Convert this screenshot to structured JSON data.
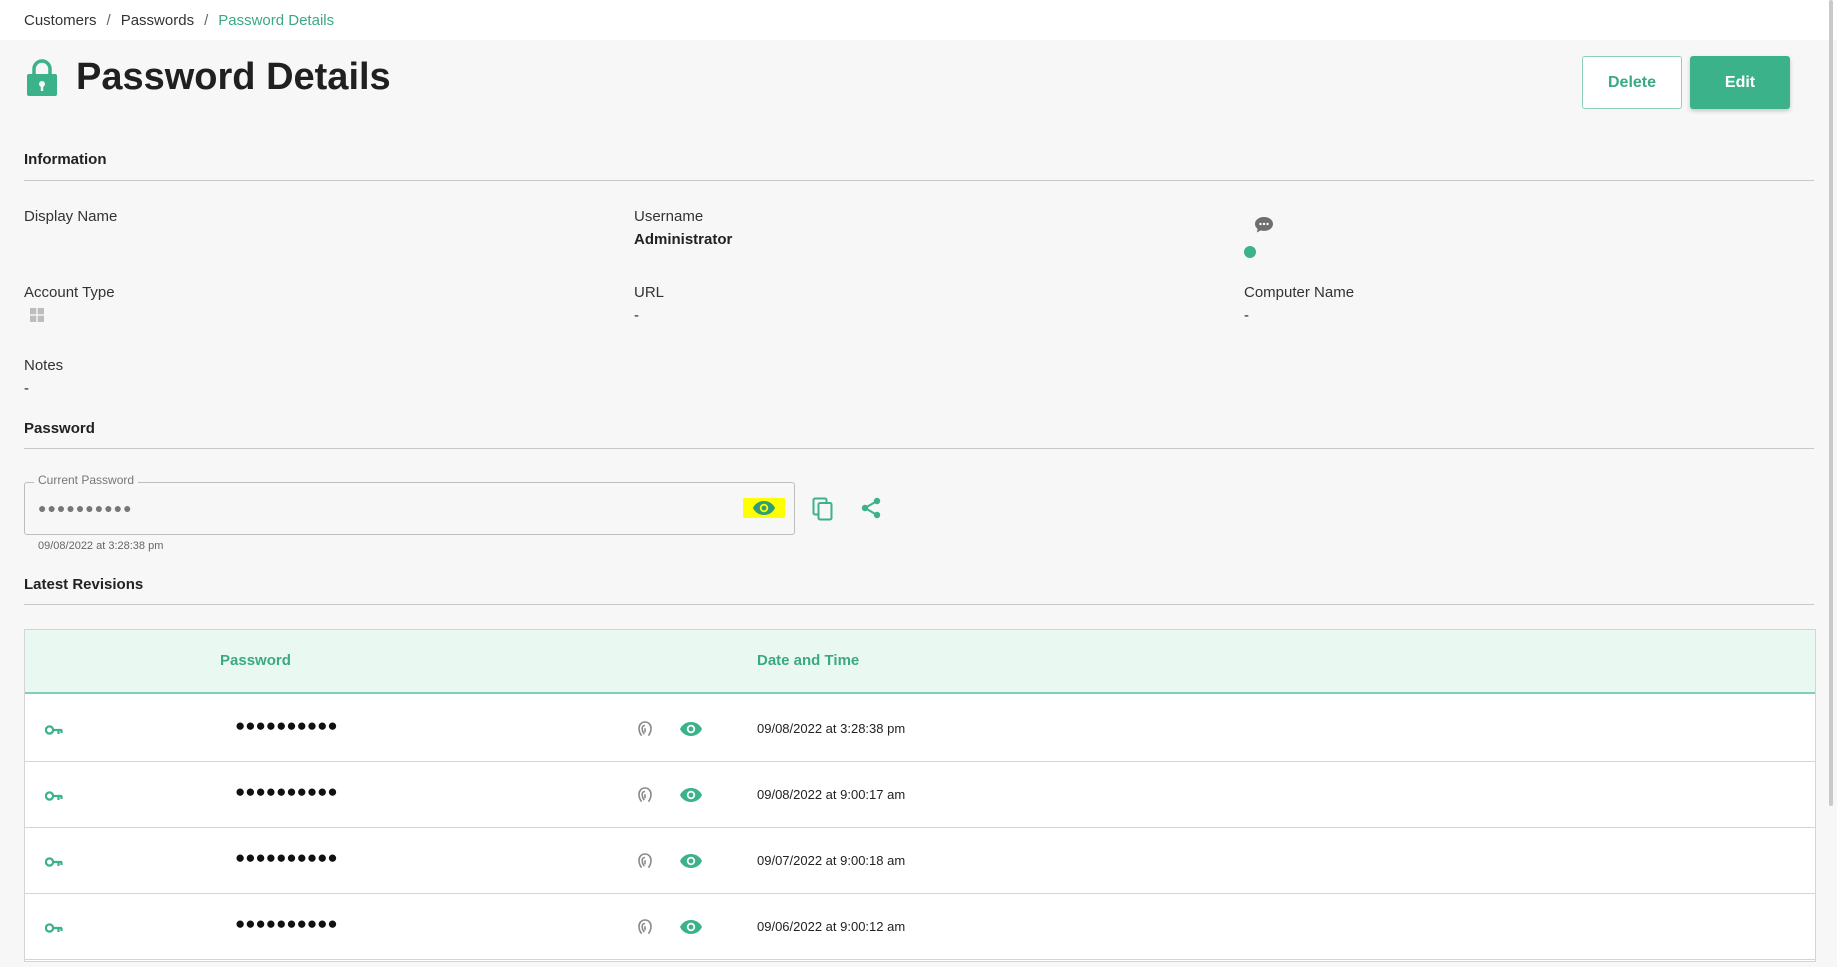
{
  "breadcrumb": {
    "items": [
      "Customers",
      "Passwords"
    ],
    "separator": "/",
    "current": "Password Details"
  },
  "page": {
    "title": "Password Details",
    "icon": "lock-icon"
  },
  "actions": {
    "delete_label": "Delete",
    "edit_label": "Edit"
  },
  "information": {
    "section_title": "Information",
    "display_name_label": "Display Name",
    "display_name_value": "",
    "username_label": "Username",
    "username_value": "Administrator",
    "account_type_label": "Account Type",
    "account_type_icon": "windows-icon",
    "url_label": "URL",
    "url_value": "-",
    "computer_name_label": "Computer Name",
    "computer_name_value": "-",
    "notes_label": "Notes",
    "notes_value": "-",
    "status_color": "#3bb28a"
  },
  "password": {
    "section_title": "Password",
    "field_label": "Current Password",
    "masked_value": "●●●●●●●●●●",
    "timestamp": "09/08/2022 at 3:28:38 pm"
  },
  "revisions": {
    "section_title": "Latest Revisions",
    "columns": [
      "Password",
      "Date and Time"
    ],
    "rows": [
      {
        "masked": "●●●●●●●●●●",
        "date": "09/08/2022 at 3:28:38 pm"
      },
      {
        "masked": "●●●●●●●●●●",
        "date": "09/08/2022 at 9:00:17 am"
      },
      {
        "masked": "●●●●●●●●●●",
        "date": "09/07/2022 at 9:00:18 am"
      },
      {
        "masked": "●●●●●●●●●●",
        "date": "09/06/2022 at 9:00:12 am"
      }
    ]
  },
  "colors": {
    "accent": "#3bb28a",
    "highlight": "#ffff00"
  }
}
